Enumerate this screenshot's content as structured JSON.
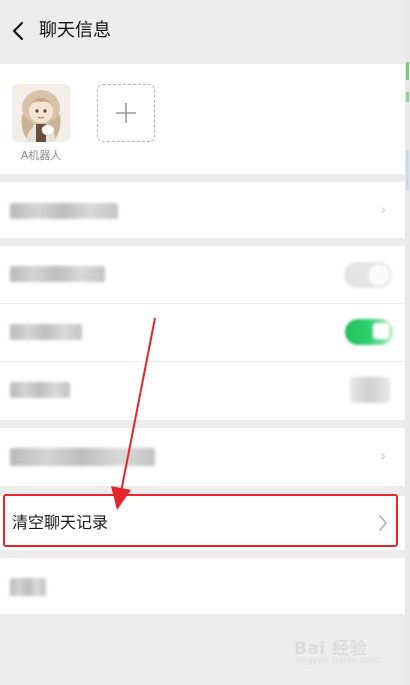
{
  "header": {
    "title": "聊天信息",
    "back_icon": "chevron-left-icon"
  },
  "members": {
    "avatar_name": "A机器人",
    "add_icon": "plus-icon"
  },
  "actions": {
    "clear_history_label": "清空聊天记录"
  },
  "annotations": {
    "highlight_color": "#e5262a",
    "arrow_color": "#e5262a"
  },
  "watermark": {
    "brand_text": "Bai 经验",
    "sub_text": "jingyan.baidu.com"
  },
  "colors": {
    "background": "#ededed",
    "card": "#ffffff",
    "toggle_on": "#2fd06d"
  }
}
